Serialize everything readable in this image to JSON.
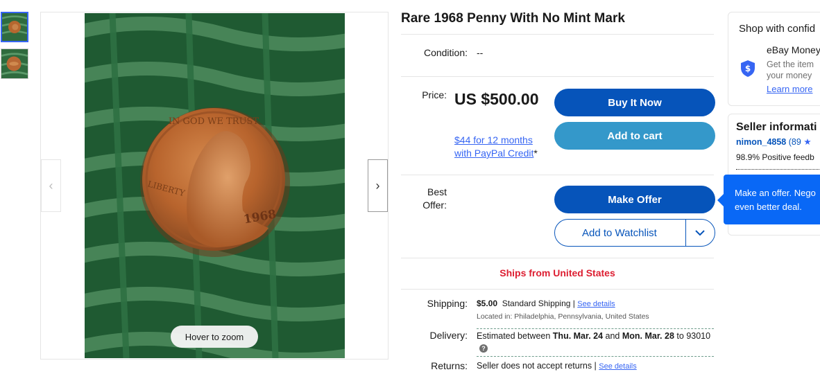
{
  "gallery": {
    "thumbnails": [
      "penny-photo-1",
      "penny-photo-2"
    ],
    "hover_to_zoom": "Hover to zoom",
    "prev_icon": "chevron-left-icon",
    "next_icon": "chevron-right-icon",
    "coin_text": {
      "motto": "IN GOD WE TRUST",
      "liberty": "LIBERTY",
      "year": "1968"
    }
  },
  "listing": {
    "title": "Rare 1968 Penny With No Mint Mark",
    "condition_label": "Condition:",
    "condition_value": "--",
    "price_label": "Price:",
    "price_value": "US $500.00",
    "credit_link": "$44 for 12 months with PayPal Credit",
    "credit_asterisk": "*",
    "best_offer_label": "Best Offer:",
    "buy_it_now": "Buy It Now",
    "add_to_cart": "Add to cart",
    "make_offer": "Make Offer",
    "add_to_watchlist": "Add to Watchlist",
    "ships_from": "Ships from United States",
    "shipping_label": "Shipping:",
    "shipping_price": "$5.00",
    "shipping_method": "Standard Shipping",
    "see_details": "See details",
    "located_in": "Located in:  Philadelphia, Pennsylvania, United States",
    "delivery_label": "Delivery:",
    "delivery_prefix": "Estimated between",
    "delivery_start": "Thu. Mar. 24",
    "delivery_and": "and",
    "delivery_end": "Mon. Mar. 28",
    "delivery_to": "to",
    "delivery_zip": "93010",
    "returns_label": "Returns:",
    "returns_value": "Seller does not accept returns"
  },
  "sidebar": {
    "shop_title": "Shop with confid",
    "money_back_title": "eBay Money",
    "money_back_desc_1": "Get the item",
    "money_back_desc_2": "your money",
    "learn_more": "Learn more",
    "seller_info_title": "Seller informati",
    "seller_name": "nimon_4858",
    "seller_count": "(89",
    "seller_feedback": "98.9% Positive feedb"
  },
  "tooltip": {
    "line1": "Make an offer. Nego",
    "line2": "even better deal."
  },
  "colors": {
    "primary_button": "#0654ba",
    "cart_button": "#3498ca",
    "link": "#3665f3",
    "ships_red": "#dd1e31",
    "tooltip_bg": "#0968f6"
  }
}
